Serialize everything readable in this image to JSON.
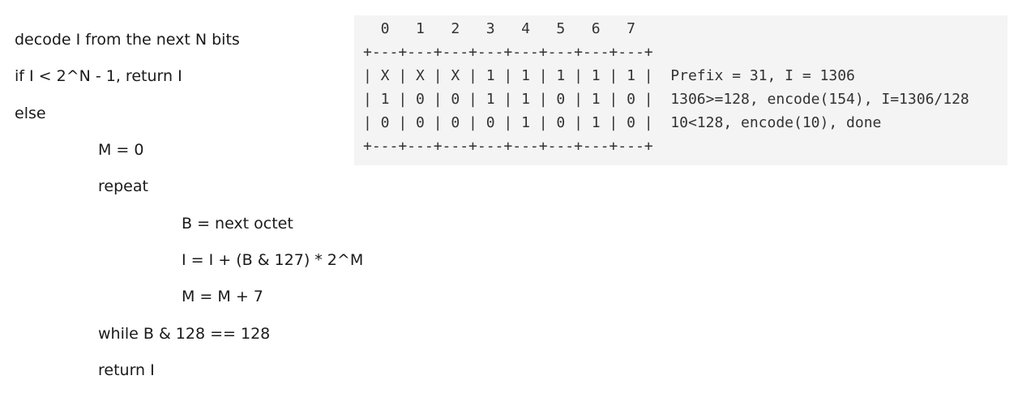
{
  "pseudocode": {
    "lines": [
      "decode I from the next N bits",
      "if I < 2^N - 1, return I",
      "else",
      "M = 0",
      "repeat",
      "B = next octet",
      "I = I + (B & 127) * 2^M",
      "M = M + 7",
      "while B & 128 == 128",
      "return I"
    ]
  },
  "example_block": {
    "lines": [
      "  0   1   2   3   4   5   6   7",
      "+---+---+---+---+---+---+---+---+",
      "| X | X | X | 1 | 1 | 1 | 1 | 1 |  Prefix = 31, I = 1306",
      "| 1 | 0 | 0 | 1 | 1 | 0 | 1 | 0 |  1306>=128, encode(154), I=1306/128",
      "| 0 | 0 | 0 | 0 | 1 | 0 | 1 | 0 |  10<128, encode(10), done",
      "+---+---+---+---+---+---+---+---+"
    ]
  }
}
